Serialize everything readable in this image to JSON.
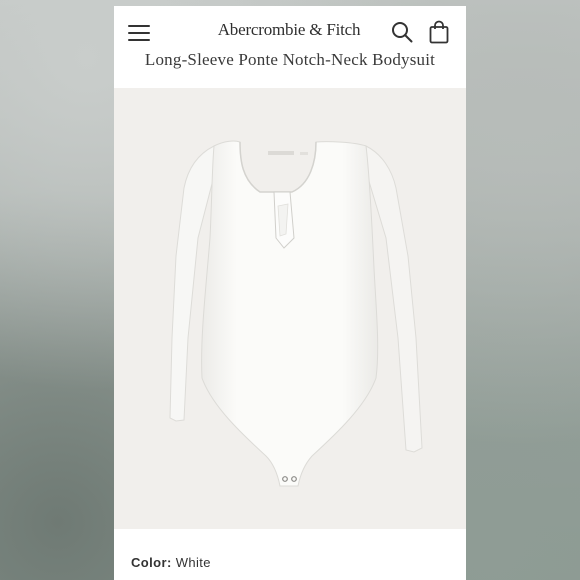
{
  "header": {
    "brand": "Abercrombie & Fitch",
    "icons": {
      "menu": "hamburger-menu-icon",
      "search": "search-icon",
      "bag": "shopping-bag-icon"
    }
  },
  "product": {
    "title": "Long-Sleeve Ponte Notch-Neck Bodysuit",
    "image_alt": "white long-sleeve bodysuit",
    "color_label": "Color:",
    "color_value": "White"
  },
  "colors": {
    "image_background": "#f1efec",
    "garment": "#fbfbf9",
    "text": "#333333"
  }
}
